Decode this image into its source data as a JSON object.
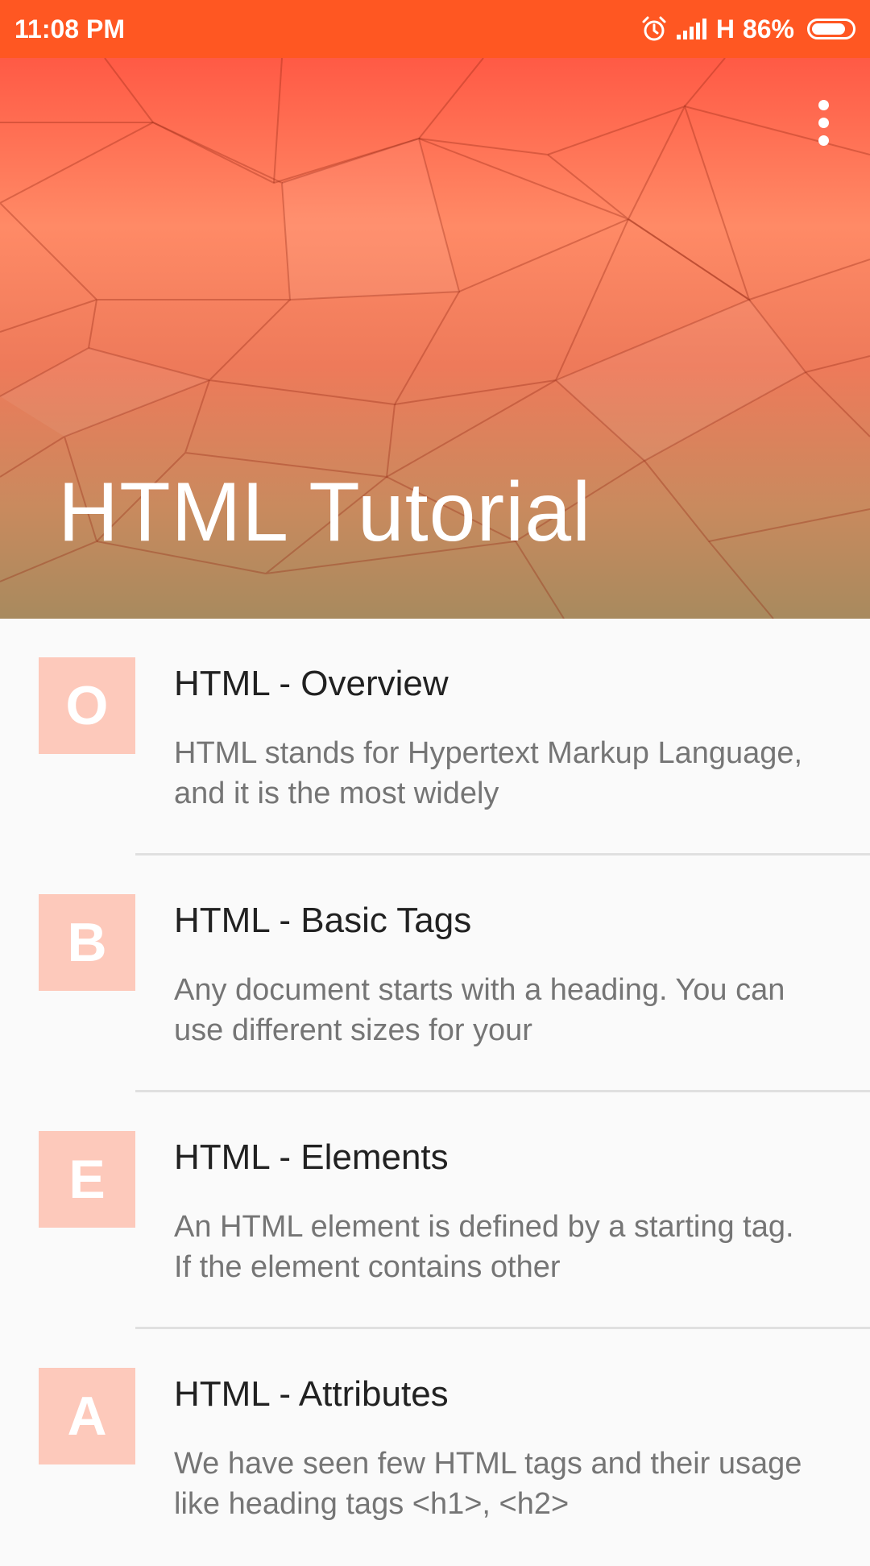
{
  "status_bar": {
    "time": "11:08 PM",
    "network": "H",
    "battery": "86%",
    "battery_level": 0.86,
    "icons": [
      "alarm-icon",
      "signal-icon",
      "battery-icon"
    ]
  },
  "header": {
    "title": "HTML Tutorial",
    "menu_icon": "more-vertical-icon"
  },
  "colors": {
    "status_bar": "#ff5722",
    "badge": "#fdc9bb",
    "title_text": "#212121",
    "desc_text": "#757575",
    "divider": "#e0e0e0"
  },
  "items": [
    {
      "letter": "O",
      "title": "HTML - Overview",
      "desc": "HTML stands for Hypertext Markup Language, and it is the most widely"
    },
    {
      "letter": "B",
      "title": "HTML - Basic Tags",
      "desc": "Any document starts with a heading. You can use different sizes for your"
    },
    {
      "letter": "E",
      "title": "HTML - Elements",
      "desc": "An HTML element is defined by a starting tag. If the element contains other"
    },
    {
      "letter": "A",
      "title": "HTML - Attributes",
      "desc": "We have seen few HTML tags and their usage like heading tags <h1>, <h2>"
    }
  ]
}
